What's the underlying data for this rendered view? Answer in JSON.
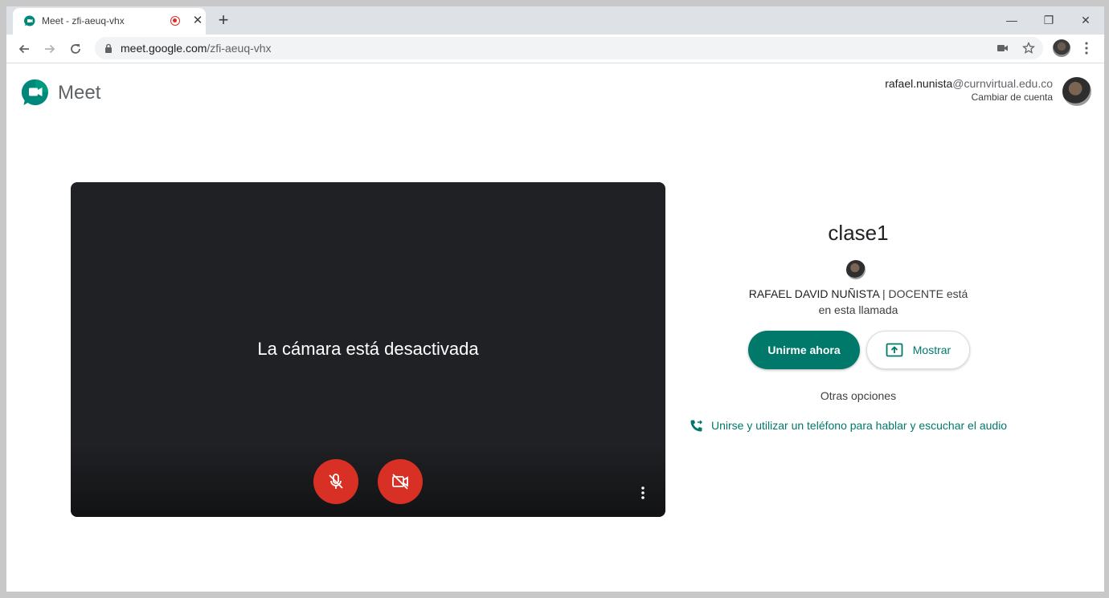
{
  "browser": {
    "tab_title": "Meet - zfi-aeuq-vhx",
    "tab_close": "✕",
    "new_tab": "+",
    "url_host": "meet.google.com",
    "url_path": "/zfi-aeuq-vhx",
    "controls": {
      "minimize": "—",
      "restore": "❐",
      "close": "✕"
    }
  },
  "header": {
    "logo_text": "Meet",
    "account_user": "rafael.nunista",
    "account_domain": "@curnvirtual.edu.co",
    "switch_account": "Cambiar de cuenta"
  },
  "preview": {
    "camera_off_message": "La cámara está desactivada",
    "mic_state": "off",
    "camera_state": "off"
  },
  "join_panel": {
    "meeting_name": "clase1",
    "participant_name": "RAFAEL DAVID NUÑISTA",
    "participant_suffix": " | DOCENTE está en esta llamada",
    "join_button": "Unirme ahora",
    "present_button": "Mostrar",
    "other_options": "Otras opciones",
    "phone_option": "Unirse y utilizar un teléfono para hablar y escuchar el audio"
  },
  "colors": {
    "accent_teal": "#00796b",
    "danger_red": "#d93025",
    "preview_bg": "#202124"
  }
}
